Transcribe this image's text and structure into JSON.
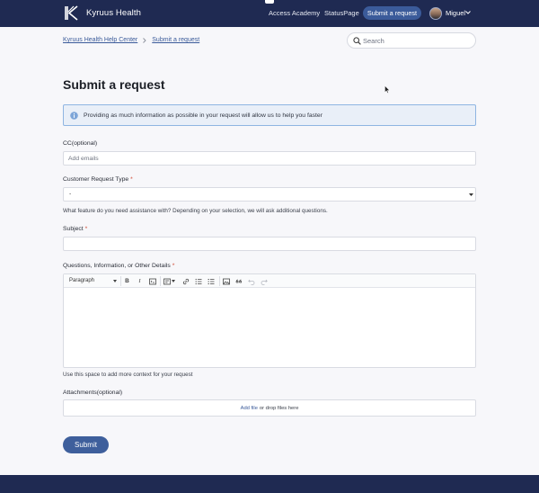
{
  "header": {
    "brand": "Kyruus Health",
    "nav": {
      "academy": "Access Academy",
      "status": "StatusPage",
      "submit": "Submit a request"
    },
    "user": "Miguel"
  },
  "breadcrumb": {
    "home": "Kyruus Health Help Center",
    "current": "Submit a request"
  },
  "search": {
    "placeholder": "Search"
  },
  "page": {
    "title": "Submit a request"
  },
  "notice": {
    "text": "Providing as much information as possible in your request will allow us to help you faster"
  },
  "form": {
    "cc": {
      "label": "CC",
      "optional": "(optional)",
      "placeholder": "Add emails"
    },
    "request_type": {
      "label": "Customer Request Type",
      "required": "*",
      "value": "-",
      "help": "What feature do you need assistance with? Depending on your selection, we will ask additional questions."
    },
    "subject": {
      "label": "Subject",
      "required": "*"
    },
    "details": {
      "label": "Questions, Information, or Other Details",
      "required": "*",
      "toolbar": {
        "paragraph": "Paragraph",
        "bold": "B",
        "italic": "I"
      },
      "help": "Use this space to add more context for your request"
    },
    "attachments": {
      "label": "Attachments",
      "optional": "(optional)",
      "add_file": "Add file",
      "drop_text": "or drop files here"
    },
    "submit": "Submit"
  },
  "colors": {
    "header_bg": "#1f2a52",
    "accent": "#3e5f9c",
    "notice_bg": "#e9eff8",
    "required": "#d0452f"
  }
}
